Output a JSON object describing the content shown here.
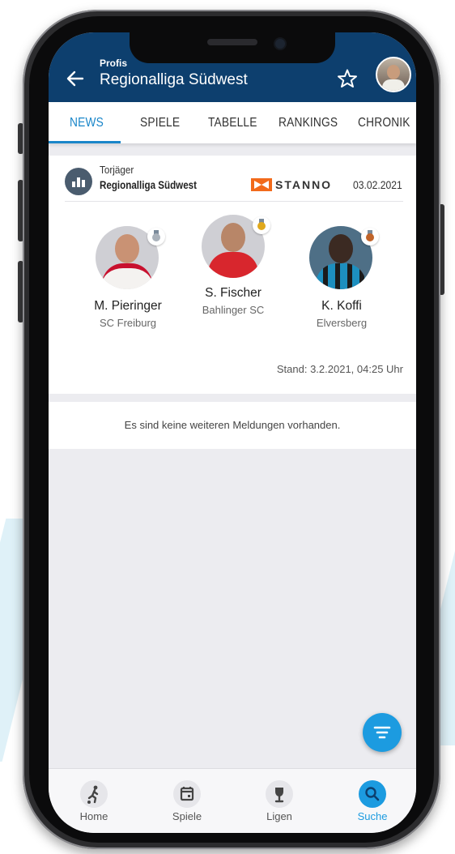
{
  "header": {
    "subtitle": "Profis",
    "title": "Regionalliga Südwest"
  },
  "tabs": [
    "NEWS",
    "SPIELE",
    "TABELLE",
    "RANKINGS",
    "CHRONIK"
  ],
  "active_tab": "NEWS",
  "card": {
    "subtitle": "Torjäger",
    "title": "Regionalliga Südwest",
    "sponsor": "STANNO",
    "date": "03.02.2021",
    "players": [
      {
        "name": "M. Pieringer",
        "club": "SC Freiburg",
        "medal": "silver"
      },
      {
        "name": "S. Fischer",
        "club": "Bahlinger SC",
        "medal": "gold"
      },
      {
        "name": "K. Koffi",
        "club": "Elversberg",
        "medal": "bronze"
      }
    ],
    "stand": "Stand: 3.2.2021, 04:25 Uhr"
  },
  "no_more_text": "Es sind keine weiteren Meldungen vorhanden.",
  "bottom_nav": [
    {
      "label": "Home",
      "icon": "soccer-player-icon"
    },
    {
      "label": "Spiele",
      "icon": "calendar-icon"
    },
    {
      "label": "Ligen",
      "icon": "trophy-icon"
    },
    {
      "label": "Suche",
      "icon": "search-icon"
    }
  ],
  "colors": {
    "header": "#0d3f6e",
    "accent": "#1a86c9",
    "fab": "#1c9be0",
    "gold": "#e0a81c",
    "silver": "#a9b1ba",
    "bronze": "#c0642a"
  }
}
